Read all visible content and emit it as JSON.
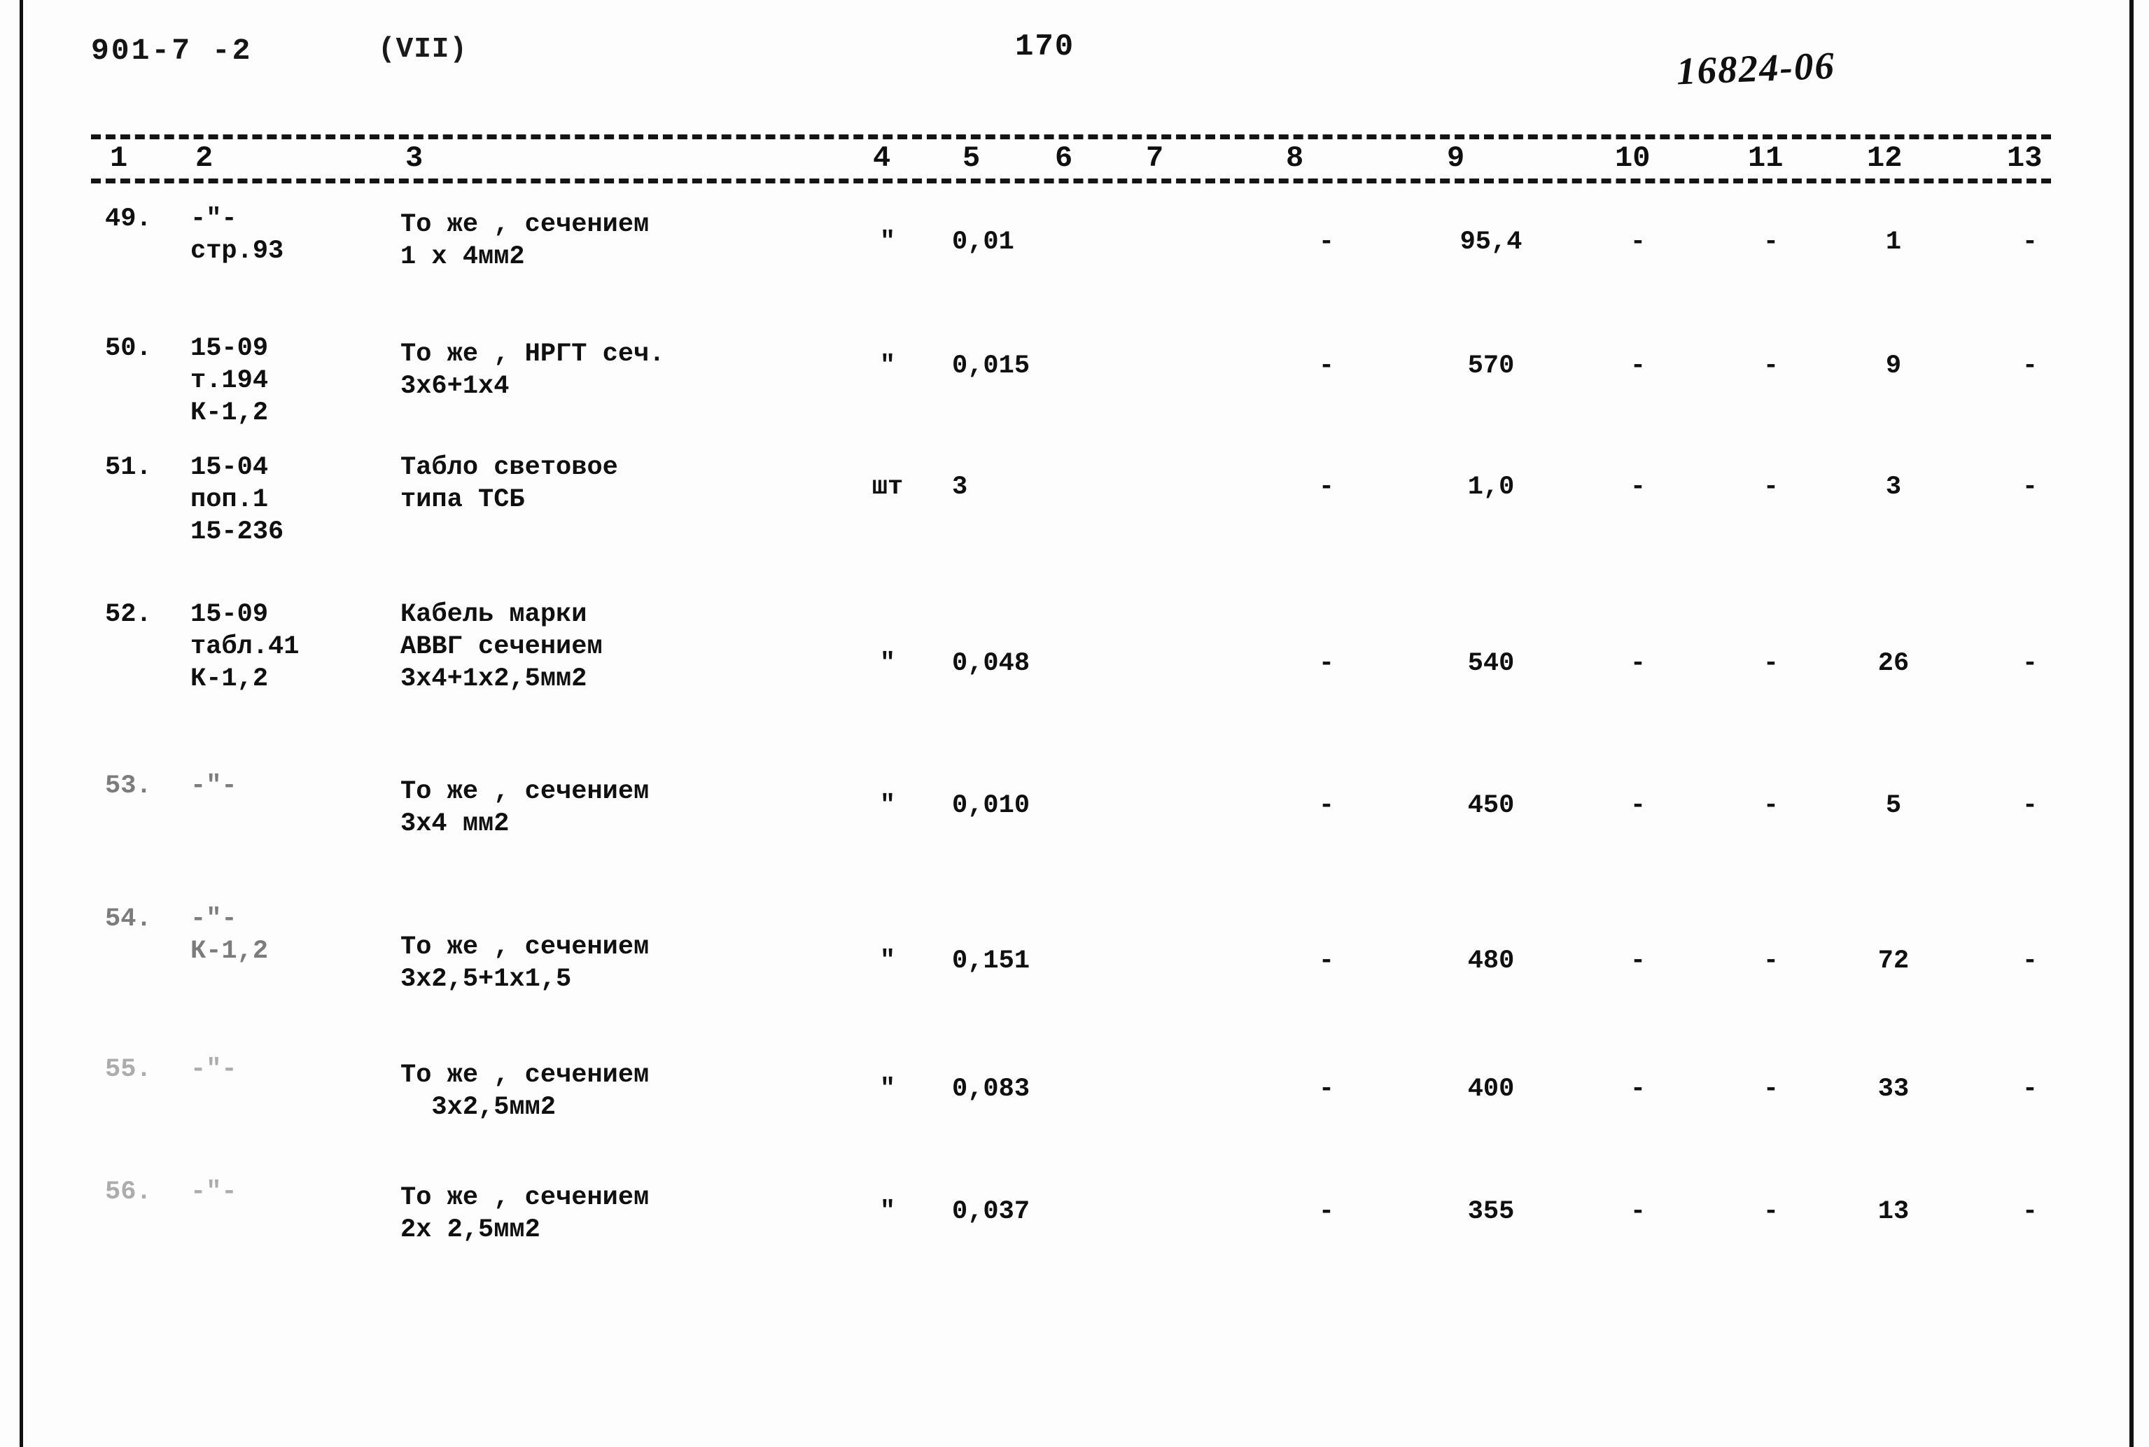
{
  "header": {
    "doc_code": "901-7 -2",
    "album": "(VII)",
    "page_number": "170",
    "stamp_number": "16824-06"
  },
  "table": {
    "column_numbers": [
      "1",
      "2",
      "3",
      "4",
      "5",
      "6",
      "7",
      "8",
      "9",
      "10",
      "11",
      "12",
      "13"
    ],
    "rows": [
      {
        "num": "49.",
        "ref": "-\"-\nстр.93",
        "desc": "То же , сечением\n1 х 4мм2",
        "unit": "\"",
        "qty": "0,01",
        "c6": "",
        "c7": "",
        "c8": "-",
        "c9": "95,4",
        "c10": "-",
        "c11": "-",
        "c12": "1",
        "c13": "-"
      },
      {
        "num": "50.",
        "ref": "15-09\nт.194\nК-1,2",
        "desc": "То же , НРГТ сеч.\n3х6+1х4",
        "unit": "\"",
        "qty": "0,015",
        "c6": "",
        "c7": "",
        "c8": "-",
        "c9": "570",
        "c10": "-",
        "c11": "-",
        "c12": "9",
        "c13": "-"
      },
      {
        "num": "51.",
        "ref": "15-04\nпоп.1\n15-236",
        "desc": "Табло световое\nтипа ТСБ",
        "unit": "шт",
        "qty": "3",
        "c6": "",
        "c7": "",
        "c8": "-",
        "c9": "1,0",
        "c10": "-",
        "c11": "-",
        "c12": "3",
        "c13": "-"
      },
      {
        "num": "52.",
        "ref": "15-09\nтабл.41\nК-1,2",
        "desc": "Кабель марки\nАВВГ сечением\n3х4+1х2,5мм2",
        "unit": "\"",
        "qty": "0,048",
        "c6": "",
        "c7": "",
        "c8": "-",
        "c9": "540",
        "c10": "-",
        "c11": "-",
        "c12": "26",
        "c13": "-"
      },
      {
        "num": "53.",
        "ref": "-\"-",
        "desc": "То же , сечением\n3х4 мм2",
        "unit": "\"",
        "qty": "0,010",
        "c6": "",
        "c7": "",
        "c8": "-",
        "c9": "450",
        "c10": "-",
        "c11": "-",
        "c12": "5",
        "c13": "-"
      },
      {
        "num": "54.",
        "ref": "-\"-\nК-1,2",
        "desc": "То же , сечением\n3х2,5+1х1,5",
        "unit": "\"",
        "qty": "0,151",
        "c6": "",
        "c7": "",
        "c8": "-",
        "c9": "480",
        "c10": "-",
        "c11": "-",
        "c12": "72",
        "c13": "-"
      },
      {
        "num": "55.",
        "ref": "-\"-",
        "desc": "То же , сечением\n  3х2,5мм2",
        "unit": "\"",
        "qty": "0,083",
        "c6": "",
        "c7": "",
        "c8": "-",
        "c9": "400",
        "c10": "-",
        "c11": "-",
        "c12": "33",
        "c13": "-"
      },
      {
        "num": "56.",
        "ref": "-\"-",
        "desc": "То же , сечением\n2х 2,5мм2",
        "unit": "\"",
        "qty": "0,037",
        "c6": "",
        "c7": "",
        "c8": "-",
        "c9": "355",
        "c10": "-",
        "c11": "-",
        "c12": "13",
        "c13": "-"
      }
    ]
  }
}
